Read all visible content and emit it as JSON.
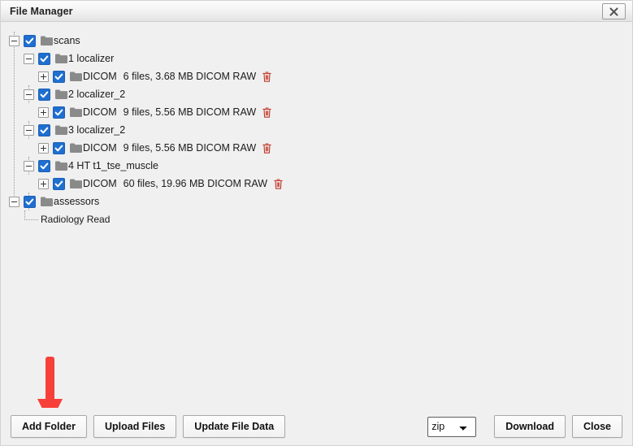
{
  "window": {
    "title": "File Manager",
    "close_icon": "close-x-icon"
  },
  "tree": {
    "nodes": [
      {
        "id": "scans",
        "level": 0,
        "expander": "minus",
        "checked": true,
        "icon": "folder-icon",
        "label": "scans",
        "meta": "",
        "deletable": false
      },
      {
        "id": "scan-1-localizer",
        "level": 1,
        "expander": "minus",
        "checked": true,
        "icon": "folder-icon",
        "label": "1 localizer",
        "meta": "",
        "deletable": false
      },
      {
        "id": "scan-1-dicom",
        "level": 2,
        "expander": "plus",
        "checked": true,
        "icon": "folder-icon",
        "label": "DICOM",
        "meta": "6 files, 3.68 MB DICOM RAW",
        "deletable": true
      },
      {
        "id": "scan-2-localizer_2",
        "level": 1,
        "expander": "minus",
        "checked": true,
        "icon": "folder-icon",
        "label": "2 localizer_2",
        "meta": "",
        "deletable": false
      },
      {
        "id": "scan-2-dicom",
        "level": 2,
        "expander": "plus",
        "checked": true,
        "icon": "folder-icon",
        "label": "DICOM",
        "meta": "9 files, 5.56 MB DICOM RAW",
        "deletable": true
      },
      {
        "id": "scan-3-localizer_2",
        "level": 1,
        "expander": "minus",
        "checked": true,
        "icon": "folder-icon",
        "label": "3 localizer_2",
        "meta": "",
        "deletable": false
      },
      {
        "id": "scan-3-dicom",
        "level": 2,
        "expander": "plus",
        "checked": true,
        "icon": "folder-icon",
        "label": "DICOM",
        "meta": "9 files, 5.56 MB DICOM RAW",
        "deletable": true
      },
      {
        "id": "scan-4-ht-t1",
        "level": 1,
        "expander": "minus",
        "checked": true,
        "icon": "folder-icon",
        "label": "4 HT t1_tse_muscle",
        "meta": "",
        "deletable": false
      },
      {
        "id": "scan-4-dicom",
        "level": 2,
        "expander": "plus",
        "checked": true,
        "icon": "folder-icon",
        "label": "DICOM",
        "meta": "60 files, 19.96 MB DICOM RAW",
        "deletable": true
      },
      {
        "id": "assessors",
        "level": 0,
        "expander": "minus",
        "checked": true,
        "icon": "folder-icon",
        "label": "assessors",
        "meta": "",
        "deletable": false
      }
    ],
    "leaf": {
      "id": "radiology-read",
      "label": "Radiology Read"
    }
  },
  "annotation": {
    "arrow_color": "#f7403a",
    "points_to": "add-folder-button"
  },
  "footer": {
    "add_folder_label": "Add Folder",
    "upload_files_label": "Upload Files",
    "update_file_data_label": "Update File Data",
    "format_select": {
      "value": "zip",
      "options": [
        "zip"
      ]
    },
    "download_label": "Download",
    "close_label": "Close"
  },
  "colors": {
    "checkbox_blue": "#1f6fd0",
    "folder_gray": "#8a8a8a",
    "trash_red": "#c0392b",
    "window_bg": "#f0f0f0",
    "titlebar_bg": "#f4f4f4"
  }
}
